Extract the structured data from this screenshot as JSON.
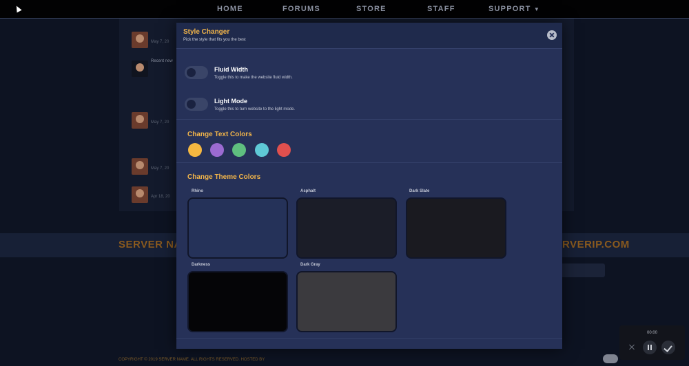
{
  "nav": {
    "items": [
      {
        "label": "HOME"
      },
      {
        "label": "FORUMS"
      },
      {
        "label": "STORE"
      },
      {
        "label": "STAFF"
      },
      {
        "label": "SUPPORT"
      }
    ]
  },
  "background": {
    "posts": [
      {
        "date": "May 7, 20"
      },
      {
        "title": "Recent new"
      },
      {
        "date": "May 7, 20"
      },
      {
        "date": "May 7, 20"
      },
      {
        "date": "Apr 18, 20"
      }
    ],
    "server_name": "SERVER NA",
    "server_ip": "RVERIP.COM",
    "footer": "COPYRIGHT © 2019 SERVER NAME. ALL RIGHTS RESERVED. HOSTED BY"
  },
  "modal": {
    "title": "Style Changer",
    "subtitle": "Pick the style that fits you the best",
    "options": [
      {
        "title": "Fluid Width",
        "desc": "Toggle this to make the website fluid width.",
        "enabled": false
      },
      {
        "title": "Light Mode",
        "desc": "Toggle this to turn website to the light mode.",
        "enabled": false
      }
    ],
    "text_colors_title": "Change Text Colors",
    "text_colors": [
      "#f5b841",
      "#9b6bd1",
      "#5fbf7f",
      "#5fc9d6",
      "#e0504e"
    ],
    "theme_colors_title": "Change Theme Colors",
    "themes": [
      {
        "label": "Rhino",
        "color": "#253259"
      },
      {
        "label": "Asphalt",
        "color": "#1b1d28"
      },
      {
        "label": "Dark Slate",
        "color": "#1a1a20"
      },
      {
        "label": "Darkness",
        "color": "#050507"
      },
      {
        "label": "Dark Gray",
        "color": "#3b3a3e"
      }
    ]
  },
  "recorder": {
    "time": "00:00"
  }
}
